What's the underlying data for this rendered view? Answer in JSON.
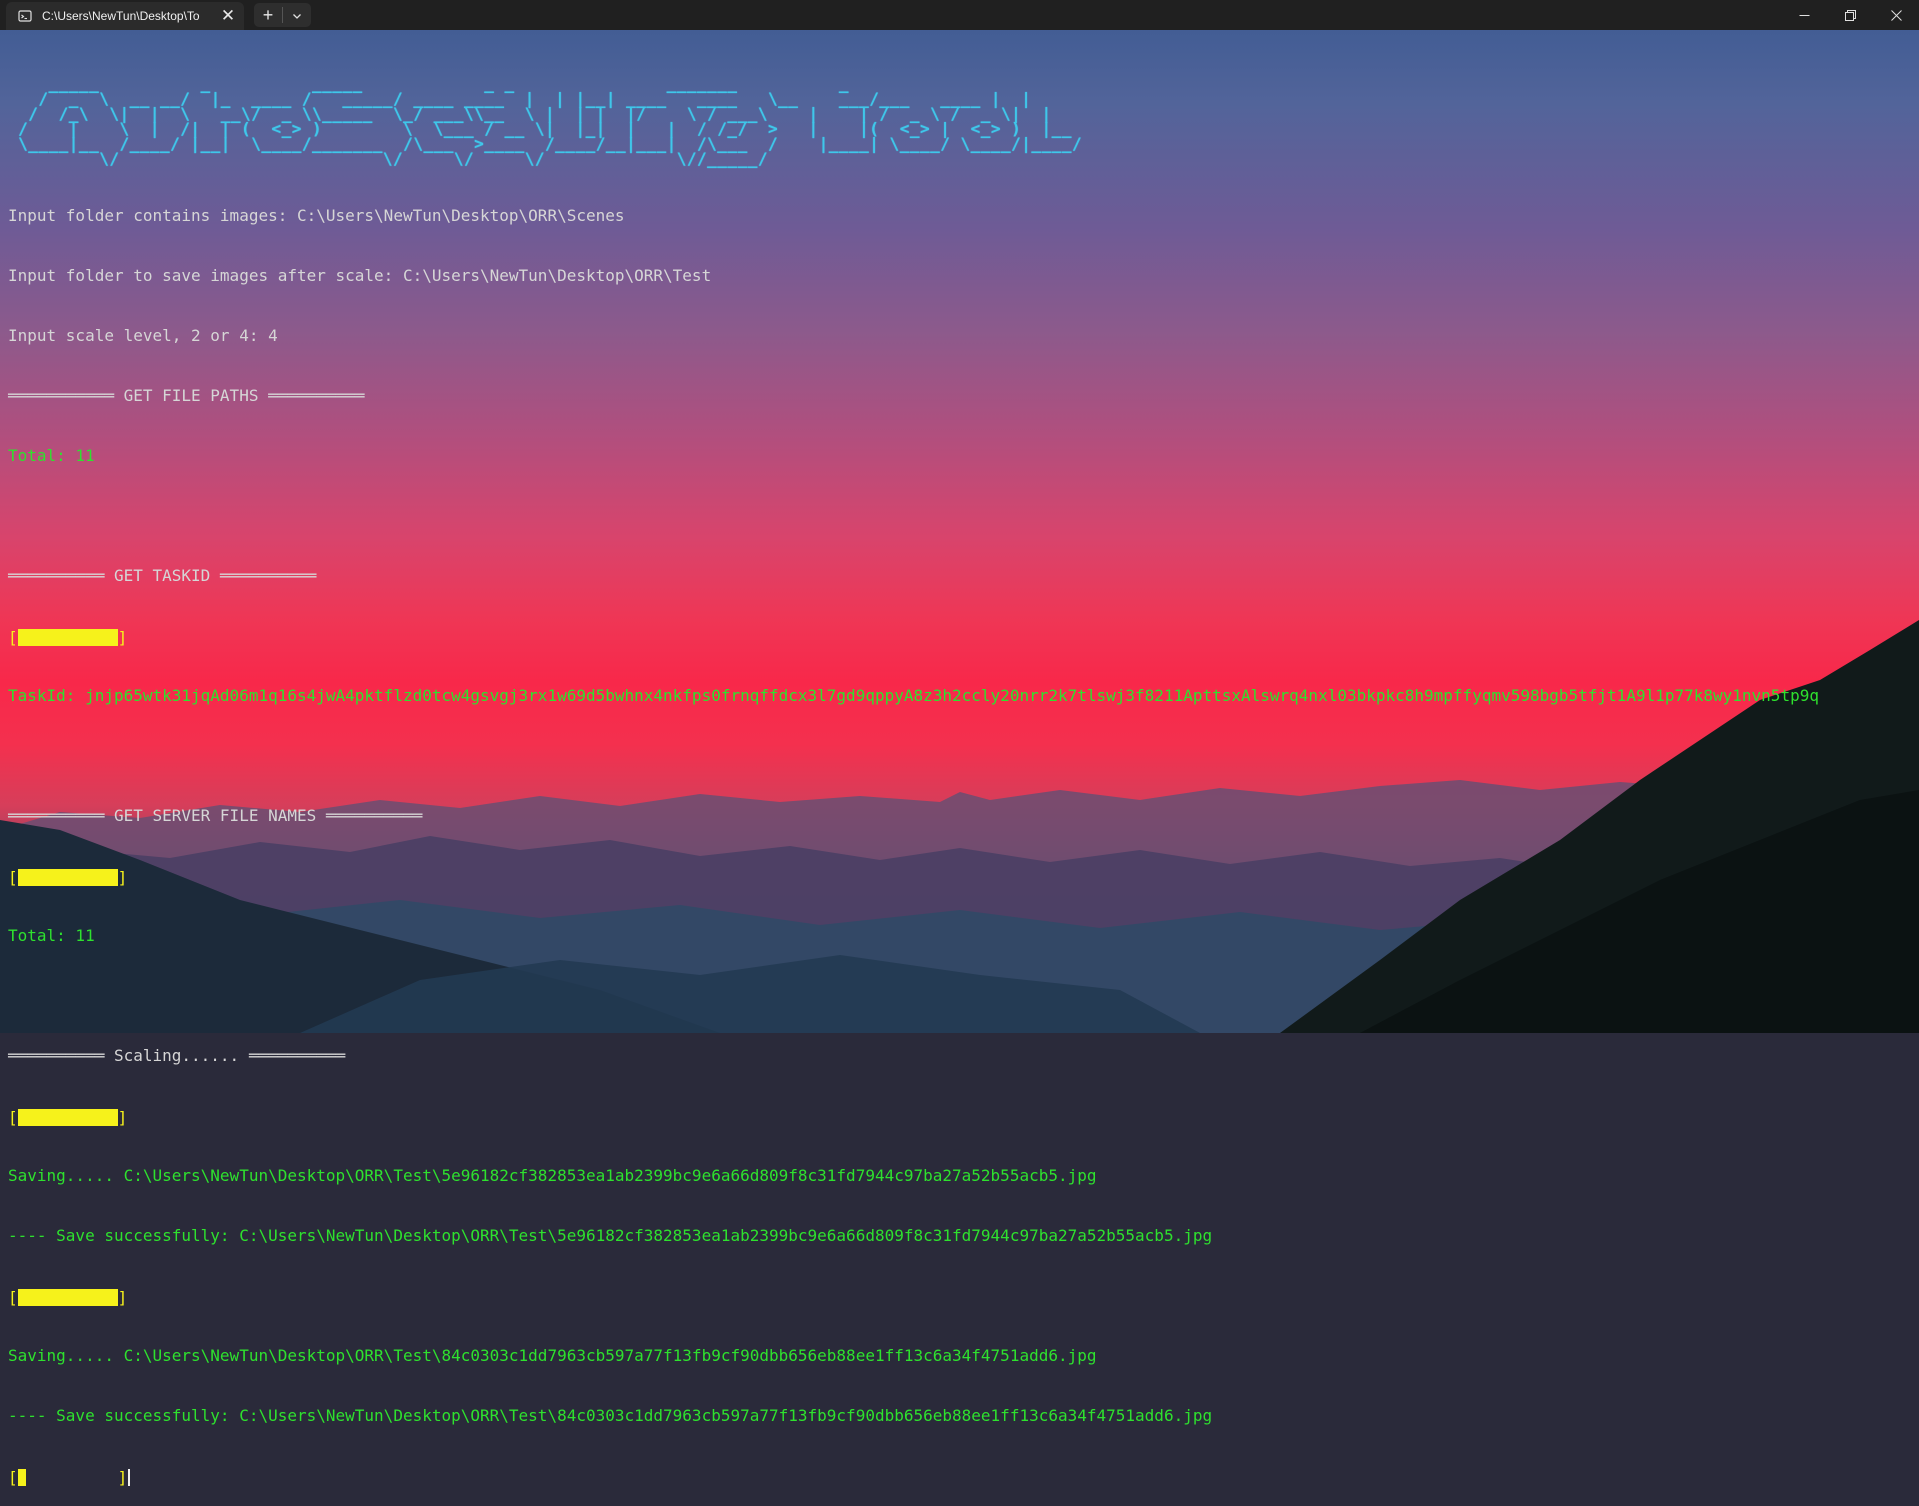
{
  "window": {
    "tab_title": "C:\\Users\\NewTun\\Desktop\\To",
    "icons": [
      "terminal-icon",
      "close-icon",
      "plus-icon",
      "chevron-down-icon",
      "minimize-icon",
      "maximize-icon",
      "close-window-icon"
    ]
  },
  "terminal": {
    "banner_art": "    _____          _          _____            _ _               _______          _ \n   /  _  \\  __ __/  |_  ____ /   _____/ ____ ____  |  | |__| ____   ____   \\__    ___/___   ____ |  |\n  /  /_\\  \\|  |  \\   __\\/  _ \\\\_____  \\_/ ___\\\\__  \\ |  | |  |/    \\ / ___\\    |    | /  _ \\ /  _ \\|  |\n /    |    \\  |  /|  | (  <_> )        \\  \\___ / __ \\|  |_|  |   |  / /_/  >   |    |(  <_> |  <_> )  |__\n \\____|__  /____/ |__|  \\____/_______  /\\___  >____  /____/__|___|  /\\___  /    |____| \\____/ \\____/|____/\n         \\/                          \\/     \\/     \\/             \\//_____/",
    "line_input_folder": "Input folder contains images: C:\\Users\\NewTun\\Desktop\\ORR\\Scenes",
    "line_output_folder": "Input folder to save images after scale: C:\\Users\\NewTun\\Desktop\\ORR\\Test",
    "line_scale": "Input scale level, 2 or 4: 4",
    "section_file_paths": "═══════════ GET FILE PATHS ══════════",
    "total_file_paths": "Total: 11",
    "section_taskid": "══════════ GET TASKID ══════════",
    "taskid_line": "TaskId: jnjp65wtk31jqAd06m1q16s4jwA4pktflzd0tcw4gsvgj3rx1w69d5bwhnx4nkfps0frnqffdcx3l7gd9qppyA8z3h2ccly20nrr2k7tlswj3f8211ApttsxAlswrq4nxl03bkpkc8h9mpffyqmv598bgb5tfjt1A9l1p77k8wy1nvn5tp9q",
    "section_server_names": "══════════ GET SERVER FILE NAMES ══════════",
    "total_server_names": "Total: 11",
    "section_scaling": "══════════ Scaling...... ══════════",
    "saving_1": "Saving..... C:\\Users\\NewTun\\Desktop\\ORR\\Test\\5e96182cf382853ea1ab2399bc9e6a66d809f8c31fd7944c97ba27a52b55acb5.jpg",
    "saved_1": "---- Save successfully: C:\\Users\\NewTun\\Desktop\\ORR\\Test\\5e96182cf382853ea1ab2399bc9e6a66d809f8c31fd7944c97ba27a52b55acb5.jpg",
    "saving_2": "Saving..... C:\\Users\\NewTun\\Desktop\\ORR\\Test\\84c0303c1dd7963cb597a77f13fb9cf90dbb656eb88ee1ff13c6a34f4751add6.jpg",
    "saved_2": "---- Save successfully: C:\\Users\\NewTun\\Desktop\\ORR\\Test\\84c0303c1dd7963cb597a77f13fb9cf90dbb656eb88ee1ff13c6a34f4751add6.jpg",
    "progress_bars": [
      {
        "label_open": "[",
        "label_close": "]",
        "fraction": 1.0
      },
      {
        "label_open": "[",
        "label_close": "]",
        "fraction": 1.0
      },
      {
        "label_open": "[",
        "label_close": "]",
        "fraction": 1.0
      },
      {
        "label_open": "[",
        "label_close": "]",
        "fraction": 1.0
      },
      {
        "label_open": "[",
        "label_close": "]",
        "fraction": 0.08
      }
    ]
  },
  "colors": {
    "banner": "#3fc7ea",
    "info_text": "#d6d6d6",
    "success_text": "#2ee12e",
    "progress": "#f6f21b"
  }
}
